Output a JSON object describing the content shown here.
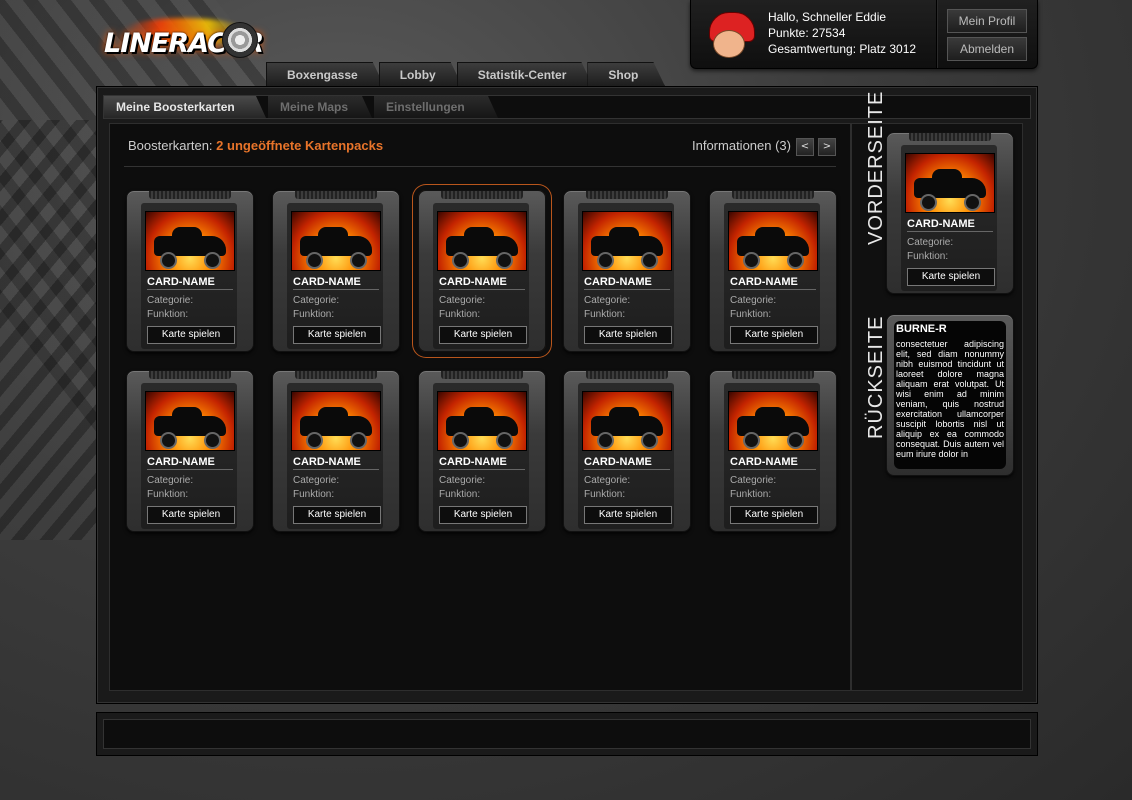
{
  "brand": {
    "logo_text": "LINERACER"
  },
  "topnav": {
    "tabs": [
      "Boxengasse",
      "Lobby",
      "Statistik-Center",
      "Shop"
    ]
  },
  "user": {
    "greeting": "Hallo, Schneller Eddie",
    "points": "Punkte: 27534",
    "rank": "Gesamtwertung: Platz 3012",
    "profile_button": "Mein Profil",
    "logout_button": "Abmelden"
  },
  "subnav": {
    "tabs": [
      "Meine Boosterkarten",
      "Meine Maps",
      "Einstellungen"
    ],
    "active": 0
  },
  "main": {
    "booster_label": "Boosterkarten:",
    "booster_highlight": "2 ungeöffnete Kartenpacks",
    "info_label": "Informationen (3)",
    "prev_label": "<",
    "next_label": ">"
  },
  "cards": [
    {
      "name": "CARD-NAME",
      "categorie": "Categorie:",
      "funktion": "Funktion:",
      "button": "Karte spielen",
      "selected": false
    },
    {
      "name": "CARD-NAME",
      "categorie": "Categorie:",
      "funktion": "Funktion:",
      "button": "Karte spielen",
      "selected": false
    },
    {
      "name": "CARD-NAME",
      "categorie": "Categorie:",
      "funktion": "Funktion:",
      "button": "Karte spielen",
      "selected": true
    },
    {
      "name": "CARD-NAME",
      "categorie": "Categorie:",
      "funktion": "Funktion:",
      "button": "Karte spielen",
      "selected": false
    },
    {
      "name": "CARD-NAME",
      "categorie": "Categorie:",
      "funktion": "Funktion:",
      "button": "Karte spielen",
      "selected": false
    },
    {
      "name": "CARD-NAME",
      "categorie": "Categorie:",
      "funktion": "Funktion:",
      "button": "Karte spielen",
      "selected": false
    },
    {
      "name": "CARD-NAME",
      "categorie": "Categorie:",
      "funktion": "Funktion:",
      "button": "Karte spielen",
      "selected": false
    },
    {
      "name": "CARD-NAME",
      "categorie": "Categorie:",
      "funktion": "Funktion:",
      "button": "Karte spielen",
      "selected": false
    },
    {
      "name": "CARD-NAME",
      "categorie": "Categorie:",
      "funktion": "Funktion:",
      "button": "Karte spielen",
      "selected": false
    },
    {
      "name": "CARD-NAME",
      "categorie": "Categorie:",
      "funktion": "Funktion:",
      "button": "Karte spielen",
      "selected": false
    }
  ],
  "side": {
    "front_label": "VORDERSEITE",
    "back_label": "RÜCKSEITE",
    "front_card": {
      "name": "CARD-NAME",
      "categorie": "Categorie:",
      "funktion": "Funktion:",
      "button": "Karte spielen"
    },
    "back_card": {
      "title": "BURNE-R",
      "body": "consectetuer adipiscing elit, sed diam nonummy nibh euismod tincidunt ut laoreet dolore magna aliquam erat volutpat. Ut wisi enim ad minim veniam, quis nostrud exercitation ullamcorper suscipit lobortis nisl ut aliquip ex ea commodo consequat. Duis autem vel eum iriure dolor in"
    }
  },
  "colors": {
    "accent": "#e8742a",
    "selected_border": "#b9561c"
  }
}
